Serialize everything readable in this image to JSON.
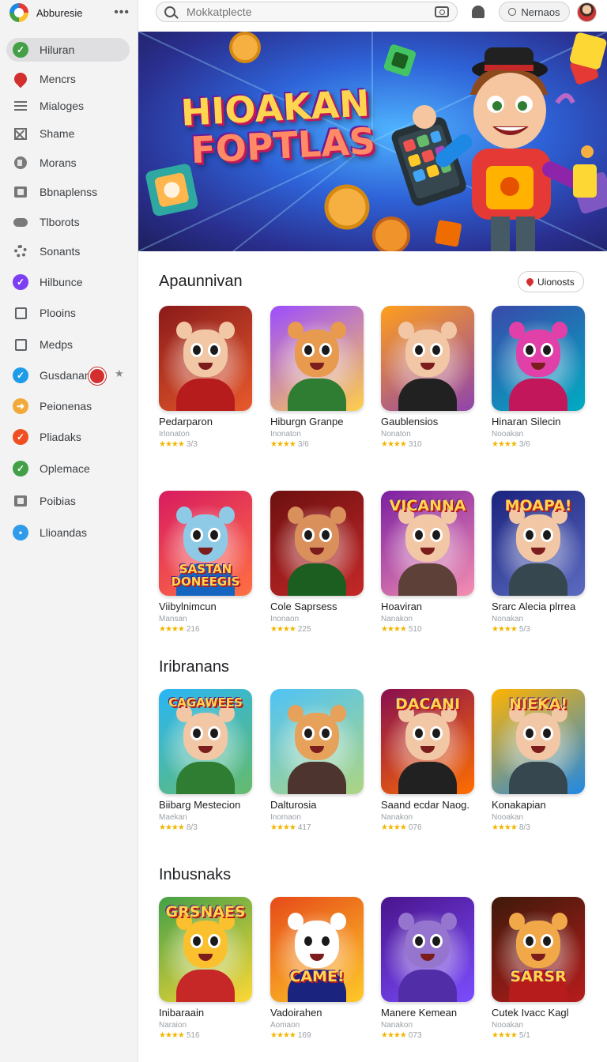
{
  "brand": {
    "name": "Abburesie"
  },
  "sidebar": {
    "items": [
      {
        "label": "Hiluran",
        "icon": "check-circle-icon",
        "color": "#43a047",
        "active": true
      },
      {
        "label": "Mencrs",
        "icon": "map-pin-icon",
        "color": "#d32f2f"
      },
      {
        "label": "Mialoges",
        "icon": "list-icon",
        "color": "#6b6b6b"
      },
      {
        "label": "Shame",
        "icon": "crossed-box-icon",
        "color": "#6b6b6b"
      },
      {
        "label": "Morans",
        "icon": "compass-icon",
        "color": "#7a7a7a"
      },
      {
        "label": "Bbnaplenss",
        "icon": "book-icon",
        "color": "#777777"
      },
      {
        "label": "Tlborots",
        "icon": "cloud-icon",
        "color": "#7a7a7a"
      },
      {
        "label": "Sonants",
        "icon": "gear-icon",
        "color": "#6b6b6b"
      },
      {
        "label": "Hilbunce",
        "icon": "check-circle-icon",
        "color": "#7e3ff2"
      },
      {
        "label": "Plooins",
        "icon": "checkbox-icon",
        "color": "#5f6368"
      },
      {
        "label": "Medps",
        "icon": "checkbox-icon",
        "color": "#5f6368"
      },
      {
        "label": "Gusdanan",
        "icon": "check-circle-icon",
        "color": "#1e9be9"
      },
      {
        "label": "Peionenas",
        "icon": "arrow-circle-icon",
        "color": "#f2a93b"
      },
      {
        "label": "Pliadaks",
        "icon": "check-circle-icon",
        "color": "#f04e23"
      },
      {
        "label": "Oplemace",
        "icon": "check-circle-icon",
        "color": "#43a047"
      },
      {
        "label": "Poibias",
        "icon": "image-icon",
        "color": "#777777"
      },
      {
        "label": "Llioandas",
        "icon": "info-circle-icon",
        "color": "#2f9be9"
      }
    ]
  },
  "search": {
    "placeholder": "Mokkatplecte"
  },
  "topbar": {
    "notifications_label": "Nernaos"
  },
  "hero": {
    "title_line1": "HIOAKAN",
    "title_line2": "FOPTLAS"
  },
  "sections": [
    {
      "title": "Apaunnivan",
      "action_label": "Uionosts",
      "cards": [
        {
          "title": "Pedarparon",
          "subtitle": "Irlonaton",
          "rating": "3/3",
          "thumb": {
            "bg": [
              "#8b1a1a",
              "#e85a2c"
            ],
            "skin": "#f2c7a5",
            "outfit": "#b71c1c",
            "text": ""
          }
        },
        {
          "title": "Hiburgn Granpe",
          "subtitle": "Inonaton",
          "rating": "3/6",
          "thumb": {
            "bg": [
              "#9c4dff",
              "#ffcf4a"
            ],
            "skin": "#e89a4e",
            "outfit": "#2e7d32",
            "text": ""
          }
        },
        {
          "title": "Gaublensios",
          "subtitle": "Nonaton",
          "rating": "310",
          "thumb": {
            "bg": [
              "#ff9f1c",
              "#8e44ad"
            ],
            "skin": "#f2c7a5",
            "outfit": "#212121",
            "text": ""
          }
        },
        {
          "title": "Hinaran Silecin",
          "subtitle": "Nooakan",
          "rating": "3/6",
          "thumb": {
            "bg": [
              "#3949ab",
              "#00acc1"
            ],
            "skin": "#e040a8",
            "outfit": "#c2185b",
            "text": ""
          }
        }
      ]
    },
    {
      "title": "",
      "cards": [
        {
          "title": "Viibylnimcun",
          "subtitle": "Mansan",
          "rating": "216",
          "thumb": {
            "bg": [
              "#d81b60",
              "#ff7043"
            ],
            "skin": "#8ecae6",
            "outfit": "#1565c0",
            "text": "SASTAN DONEEGIS"
          }
        },
        {
          "title": "Cole Saprsess",
          "subtitle": "Inonaon",
          "rating": "225",
          "thumb": {
            "bg": [
              "#6d1010",
              "#c62828"
            ],
            "skin": "#d9905a",
            "outfit": "#1b5e20",
            "text": ""
          }
        },
        {
          "title": "Hoaviran",
          "subtitle": "Nanakon",
          "rating": "510",
          "thumb": {
            "bg": [
              "#7b1fa2",
              "#f48fb1"
            ],
            "skin": "#f2c7a5",
            "outfit": "#5d4037",
            "text": "VICANNA"
          }
        },
        {
          "title": "Srarc Alecia plrrea",
          "subtitle": "Nonakan",
          "rating": "5/3",
          "thumb": {
            "bg": [
              "#1a237e",
              "#5c6bc0"
            ],
            "skin": "#f2c7a5",
            "outfit": "#37474f",
            "text": "MOAPA!"
          }
        }
      ]
    },
    {
      "title": "Iribranans",
      "cards": [
        {
          "title": "Biibarg Mestecion",
          "subtitle": "Maekan",
          "rating": "8/3",
          "thumb": {
            "bg": [
              "#29b6f6",
              "#66bb6a"
            ],
            "skin": "#f2c7a5",
            "outfit": "#2e7d32",
            "text": "CAGAWEES"
          }
        },
        {
          "title": "Dalturosia",
          "subtitle": "Inomaon",
          "rating": "417",
          "thumb": {
            "bg": [
              "#4fc3f7",
              "#aed581"
            ],
            "skin": "#e6a15b",
            "outfit": "#4e342e",
            "text": ""
          }
        },
        {
          "title": "Saand ecdar Naog.",
          "subtitle": "Nanakon",
          "rating": "076",
          "thumb": {
            "bg": [
              "#880e4f",
              "#ff6f00"
            ],
            "skin": "#f2c7a5",
            "outfit": "#212121",
            "text": "DACANI"
          }
        },
        {
          "title": "Konakapian",
          "subtitle": "Nooakan",
          "rating": "8/3",
          "thumb": {
            "bg": [
              "#ffb300",
              "#1e88e5"
            ],
            "skin": "#f2c7a5",
            "outfit": "#37474f",
            "text": "NIEKA!"
          }
        }
      ]
    },
    {
      "title": "Inbusnaks",
      "cards": [
        {
          "title": "Inibaraain",
          "subtitle": "Naraion",
          "rating": "516",
          "thumb": {
            "bg": [
              "#43a047",
              "#fdd835"
            ],
            "skin": "#fbc02d",
            "outfit": "#c62828",
            "text": "GRSNAES"
          }
        },
        {
          "title": "Vadoirahen",
          "subtitle": "Aomaon",
          "rating": "169",
          "thumb": {
            "bg": [
              "#e64a19",
              "#ffca28"
            ],
            "skin": "#ffffff",
            "outfit": "#1a237e",
            "text": "CAME!"
          }
        },
        {
          "title": "Manere Kemean",
          "subtitle": "Nanakon",
          "rating": "073",
          "thumb": {
            "bg": [
              "#4a148c",
              "#7c4dff"
            ],
            "skin": "#9575cd",
            "outfit": "#512da8",
            "text": ""
          }
        },
        {
          "title": "Cutek Ivacc Kagl",
          "subtitle": "Nooakan",
          "rating": "5/1",
          "thumb": {
            "bg": [
              "#3e1a0a",
              "#b71c1c"
            ],
            "skin": "#f0a848",
            "outfit": "#b71c1c",
            "text": "SARSR"
          }
        }
      ]
    }
  ]
}
